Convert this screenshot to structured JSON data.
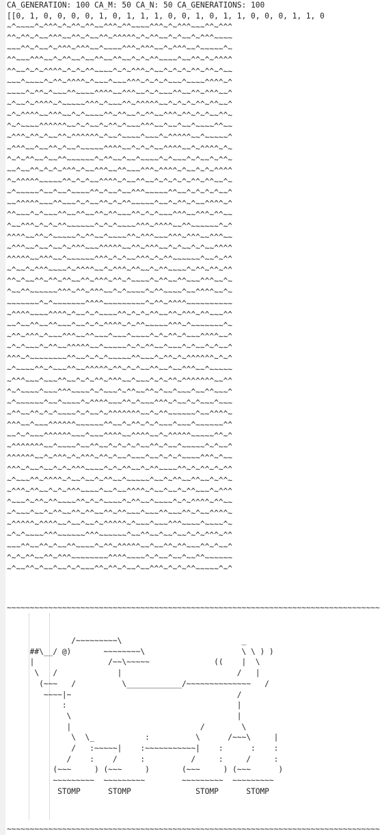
{
  "header": {
    "text": "CA_GENERATION: 100 CA_M: 50 CA_N: 50 CA_GENERATIONS: 100"
  },
  "array_line": {
    "text": "[[0, 1, 0, 0, 0, 0, 1, 0, 1, 1, 1, 0, 0, 1, 0, 1, 1, 0, 0, 0, 1, 1, 0"
  },
  "grid": {
    "rows": [
      "~^~~~~^~^^^~^~^^~^^~~^^^~^^~~~~^^^~^~^^^~~~^^~^^^",
      "^^~^^~^~~^^^~~^^~^~~^^~^^^^^~^~^^~~^~^~~^~^^^~~~~",
      "~~~^^~^~~^~^^^~^^^~~^~~~~^^^~^^^~~^~^^^~~^~~~~~^~",
      "^^~~~^^^~~^~^^~~^~~^^~~^^~~^~^~^^~~~~^~~^^~^~^^^^",
      "^^~~^~^~^^^^~^~^~^^~~~~^~^~^^^~^~~^~^~^~^^~^^~^~~",
      "~~~^~~~~^~^^~^^^^~^~~~^~~~^^^~^~^~^~~~^~~~~^^^^~^",
      "~~~~^~^^~^~~~^^~~~~^^^^~~^^^~~^~^~~~^^~~^^~^^^~~^",
      "~^~~^~^^^^~^~~~~~^^^~^~~~^^~^^^^^~~^~^~^~^^~^^~~^",
      "~^~^^^^~~^^^~~^~^~~~~^^~^^~~^~^^~~^^^~^^~^~^~~^^~",
      "^~^~~~~^^^^^^~~^~^~~^~^^~^~~~^^^~~^~~^~~^~~~~^^~~",
      "~^^^~^^~^~~^^~^^^^^^~^~~^~~~~^~~~^~^^^^^~~^~~~~~^",
      "~^^^~~^~~^^~^~~^~~~~~^^^^~~^~^~^~~^^^^~~^~^^^^~^~",
      "^~^~^^~~^~~^^~~~~~~^~^^~~^~~^~~~~^~^~~~^~^~~^~^^~",
      "~~^~~^^~^~^~^^^~^~~^^^~~^^~~~^^^~^^^^~^~~^~^~^^^^",
      "^~^^^^^~~~~~^^~^~^~~^^^^~^~~^^~~^~^~^~^~^^~^^~~^~",
      "~^~~~~~^~~^~~^~~~~^^~^~~^~~^^^~~~~~^^~~^~^~^~^~~^",
      "~~^^^^^~~~^^~~~^~^~~^^~^~^^~~~~~^~~^~^^~^~~^^^^~^",
      "^^~~~^~^~~~^^~~^^~~^^~^^~~~^^~^~^~~~^^^~~^^^~^^~~",
      "^~~^^^~^~^~^^~~~~~~^~^~^~~~~^^^~^^^^~~^^~~~~~~^~^",
      "^^^^~~^^~^~~~~~^~^^~~^~~~~^^~^^^~~~^^^~^^^~~^^^~~",
      "~^^^~~^~~^~~^~^^^~~~^^^^^~~^^~^^^~~^~^~~^~^~~^^^^",
      "^^^^^~~^^^~~^~~~~~~^^^~^~^~~^^^~^~^^~~~~~~^~~^~^^",
      "~^~~^~^^^~~~~^~^^^^~~^~^^^~^^~~^~^^~~~~^~^^~^^~^^",
      "^^~^~~^^~^^~^^~~^^~^^^~^^~^~~~~^~^^~~^^~~~^^^~~^~",
      "^~~^^~~~~~~^^^~^^~^^^~~^~^~~~~^~^^~~~~^~~^^^^~~^~",
      "~~~~~~~^~^~~~~~~~^^^^~~~~~~~~~^~^^~^^^^~~~~~~~~~~",
      "~^^^^~~~~^^^^~^~~^~^~~~~^^~^~^~^^~~^^~^^^~^^~~~^^",
      "~~^~~^^~~^^~~~^~~^~^~^^^^~^~^^~~~~~^^^~^~~~~~~~^~",
      "~^^~^^^~^~~~^^^~~^^~~~^~~~^~~~~^~^~^^~^~~~^^^^~~^",
      "~^~^~~~^~^^~~^^^^^~~^~~~~~^~^~^^~~^~~~^~^~~^~^~~^",
      "^^^~^~~~~~~~~^^~~^~^~^~~~~~^^~~~^~^^~^~^^^^^^~^~^",
      "~^~~~~^^~^~~~^^~~^^^^^~^^~^~^~~^^~~^~~^^^~~^~~~~~",
      "~^^^~~~^~~~^^~~^~^~^^~^^^~~^~~~^~^~^^~^^^^^^^~~^^",
      "^~^~~~~^~~~^^^~~~~^~^~~~^~^^~~^^~^~~^~~~^~~^^~~~^",
      "~^~~~~~~^~~^~~~~^~^^^^~~~^^~^~~~^^^~^~~^~^~~~^~~~",
      "~^^~~^^~^~^~~~~^~^~~^~^^^^^^^~~^~^^~~~~~~^~~^^^^~",
      "^^^~~^~~~^^^^^^~~~~~~^^~~^~^^~^~^~~~^~~~^~~~~~~^^",
      "~~^~^~~~^^^^^^~~~^~~~^^^^~~^^^^~~^~^^^^^~~~~~^^~^",
      "~^^^^^^^~~^~~~~^~~^^~~^~^~^~^~~^^~^~~^~~~~~^~^~~^",
      "^^^^^^~~^~^^^~^~^^^~^^~^~~^~~~^~~^~^~^~~~~^^^~^~~",
      "^^^~^~~^~~^~^~^^^~~~~^~^~^^~~^~^^~~~~^^~^~^^~^~^^",
      "~^~~~^^~^^^^~^~~^~~^~^^~~^~~~~~^~~^~^^~~^^~~^~^^~",
      "~^^^~^^~~^~^~^^^~~~~^~~^~~^^^^~^~~^~~^~^^~~~^~^^^",
      "^~~~^~^^~^^~~~~^^~^~^~~~~^~^^~~^~~~~^~^~^^^^~^^~~",
      "~^~~~^~~^~^^~~^^~^^~~^^~^^~~~^~~~^^~~~^^~^~~^^^^~",
      "~^^^^^~^^^^~~^~~^~~^~^^^^^~^~~~^~~~^^^~~~~^~~~~^~",
      "~^~^~~~~^^^~~~~~~^^^~~~~~~^~~^^~~^~~^~~^~^~^^^~^^",
      "~~~^^~~^^~^~~^^~~~~^~^^~^^^^^~~^~~^^~^^~~~^^~^~~^",
      "^~^~^^~~^^~^^^~~~~~~~~^^^^~~~~^~^~~^~~^~~^^~~~~~~",
      "~^~~^^~^~~^~~^~^~~~^^~^^~^~~^~~^^^~^~^~^^~~~~~^~^"
    ]
  },
  "separator": {
    "text": "~~~~~~~~~~~~~~~~~~~~~~~~~~~~~~~~~~~~~~~~~~~~~~~~~~~~~~~~~~~~~~~~~~~~~~~~~~~~~~~~~~"
  },
  "ascii_art": {
    "lines": [
      "              /~~~~~~~~~\\                          _",
      "     ##\\__/ @)       ~~~~~~~~\\                     \\ \\ ) )",
      "     |                /~~\\~~~~~              ((    |  \\",
      "      \\   /             |                         /   |",
      "       (~~~   /          \\____________/~~~~~~~~~~~~~~   /",
      "        ~~~~|~                                    /",
      "            :                                     |",
      "             \\                                    |",
      "             |                            /        \\",
      "              \\  \\_           :          \\      /~~~\\     |",
      "              /   :~~~~~|    :~~~~~~~~~~~|    :      :    :",
      "             /    :    /     :          /     :     /     :",
      "          (~~~     ) (~~~     )       (~~~     ) (~~~      )",
      "          ~~~~~~~~~  ~~~~~~~~~        ~~~~~~~~~  ~~~~~~~~~",
      "           STOMP      STOMP              STOMP      STOMP"
    ]
  }
}
